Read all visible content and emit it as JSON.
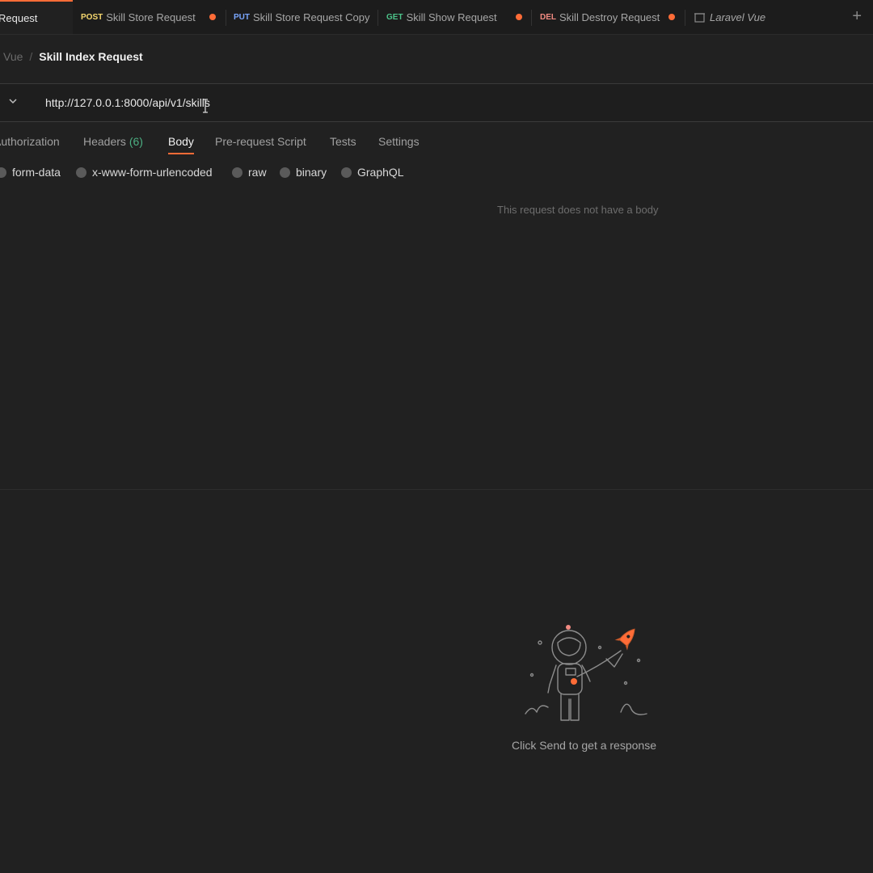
{
  "tabs": [
    {
      "method": "",
      "label": "Request",
      "active": true,
      "unsaved": false
    },
    {
      "method": "POST",
      "label": "Skill Store Request",
      "unsaved": true
    },
    {
      "method": "PUT",
      "label": "Skill Store Request Copy",
      "unsaved": false
    },
    {
      "method": "GET",
      "label": "Skill Show Request",
      "unsaved": true
    },
    {
      "method": "DEL",
      "label": "Skill Destroy Request",
      "unsaved": true
    },
    {
      "method": "",
      "label": "Laravel Vue",
      "icon": "collection-icon"
    }
  ],
  "colors": {
    "accent": "#ff6c37",
    "post": "#f5d76e",
    "put": "#7aa7ff",
    "get": "#4cc38a",
    "del": "#f28b82"
  },
  "breadcrumb": {
    "parent": "l Vue",
    "separator": "/",
    "current": "Skill Index Request"
  },
  "request": {
    "url": "http://127.0.0.1:8000/api/v1/skills"
  },
  "request_tabs": {
    "authorization": "Authorization",
    "headers": "Headers",
    "headers_count": "(6)",
    "body": "Body",
    "prerequest": "Pre-request Script",
    "tests": "Tests",
    "settings": "Settings"
  },
  "body_types": {
    "form_data": "form-data",
    "urlencoded": "x-www-form-urlencoded",
    "raw": "raw",
    "binary": "binary",
    "graphql": "GraphQL"
  },
  "body_empty_message": "This request does not have a body",
  "response": {
    "hint": "Click Send to get a response"
  }
}
